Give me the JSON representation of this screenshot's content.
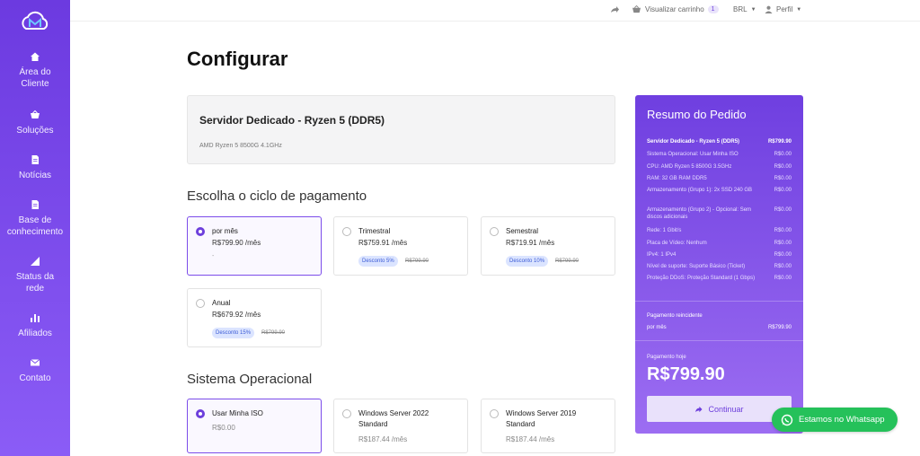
{
  "sidebar": {
    "items": [
      {
        "label": "Área do Cliente",
        "icon": "home-icon"
      },
      {
        "label": "Soluções",
        "icon": "basket-icon"
      },
      {
        "label": "Notícias",
        "icon": "document-icon"
      },
      {
        "label": "Base de conhecimento",
        "icon": "document-icon"
      },
      {
        "label": "Status da rede",
        "icon": "signal-icon"
      },
      {
        "label": "Afiliados",
        "icon": "bar-chart-icon"
      },
      {
        "label": "Contato",
        "icon": "envelope-icon"
      }
    ]
  },
  "topbar": {
    "cart_label": "Visualizar carrinho",
    "cart_count": "1",
    "currency": "BRL",
    "profile": "Perfil"
  },
  "page_title": "Configurar",
  "product": {
    "name": "Servidor Dedicado - Ryzen 5 (DDR5)",
    "subtitle": "AMD Ryzen 5 8500G 4.1GHz"
  },
  "billing": {
    "title": "Escolha o ciclo de pagamento",
    "options": [
      {
        "title": "por mês",
        "price": "R$799.90 /mês",
        "extra": "-",
        "selected": true
      },
      {
        "title": "Trimestral",
        "price": "R$759.91 /mês",
        "discount": "Desconto 5%",
        "old": "R$799.90"
      },
      {
        "title": "Semestral",
        "price": "R$719.91 /mês",
        "discount": "Desconto 10%",
        "old": "R$799.90"
      },
      {
        "title": "Anual",
        "price": "R$679.92 /mês",
        "discount": "Desconto 15%",
        "old": "R$799.90"
      }
    ]
  },
  "os": {
    "title": "Sistema Operacional",
    "options": [
      {
        "title": "Usar Minha ISO",
        "price": "R$0.00",
        "selected": true
      },
      {
        "title": "Windows Server 2022 Standard",
        "price": "R$187.44 /mês"
      },
      {
        "title": "Windows Server 2019 Standard",
        "price": "R$187.44 /mês"
      }
    ]
  },
  "summary": {
    "title": "Resumo do Pedido",
    "rows": [
      {
        "k": "Servidor Dedicado - Ryzen 5 (DDR5)",
        "v": "R$799.90"
      },
      {
        "k": "Sistema Operacional: Usar Minha ISO",
        "v": "R$0.00"
      },
      {
        "k": "CPU: AMD Ryzen 5 8500G 3.5GHz",
        "v": "R$0.00"
      },
      {
        "k": "RAM: 32 GB RAM DDR5",
        "v": "R$0.00"
      },
      {
        "k": "Armazenamento (Grupo 1): 2x SSD 240 GB",
        "v": "R$0.00"
      },
      {
        "k": "Armazenamento (Grupo 2) - Opcional: Sem discos adicionais",
        "v": "R$0.00"
      },
      {
        "k": "Rede: 1 Gbit/s",
        "v": "R$0.00"
      },
      {
        "k": "Placa de Vídeo: Nenhum",
        "v": "R$0.00"
      },
      {
        "k": "IPv4: 1 IPv4",
        "v": "R$0.00"
      },
      {
        "k": "Nível de suporte: Suporte Básico (Ticket)",
        "v": "R$0.00"
      },
      {
        "k": "Proteção DDoS: Proteção Standard (1 Gbps)",
        "v": "R$0.00"
      }
    ],
    "recurring_label": "Pagamento reincidente",
    "recurring_k": "por mês",
    "recurring_v": "R$799.90",
    "today_label": "Pagamento hoje",
    "today_value": "R$799.90",
    "continue_label": "Continuar"
  },
  "whatsapp_label": "Estamos no Whatsapp",
  "colors": {
    "accent": "#6d3fdc",
    "whatsapp": "#25c15a"
  }
}
